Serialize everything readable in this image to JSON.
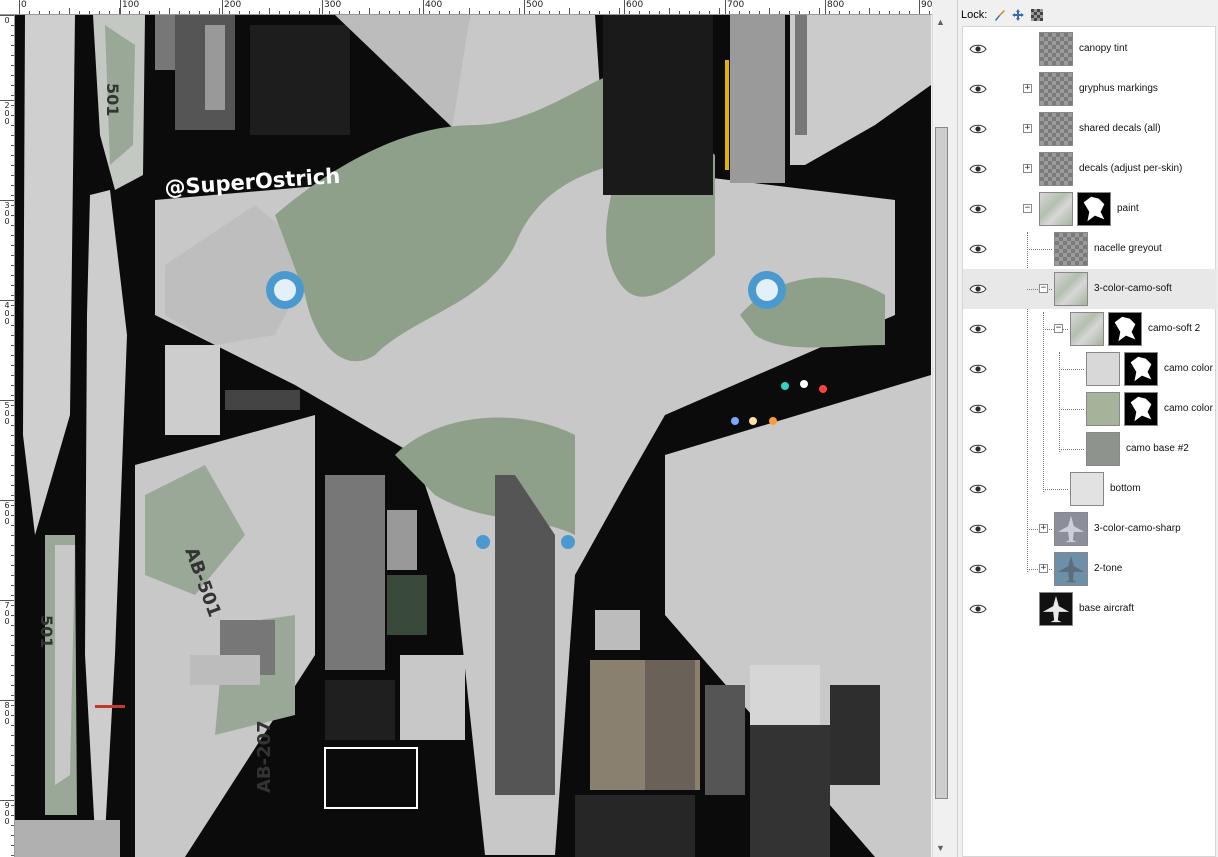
{
  "ruler": {
    "h_labels": [
      "0",
      "100",
      "200",
      "300",
      "400",
      "500",
      "600",
      "700",
      "800",
      "90"
    ],
    "v_labels": [
      "0",
      "200",
      "300",
      "400",
      "500",
      "600",
      "700",
      "800",
      "900"
    ]
  },
  "texture": {
    "watermark": "@SuperOstrich",
    "tail_codes": [
      "AB-501",
      "AB-207"
    ],
    "side_numbers": [
      "501",
      "501"
    ]
  },
  "panel": {
    "lock_label": "Lock:",
    "lock_icons": [
      "brush-icon",
      "move-icon",
      "alpha-icon"
    ]
  },
  "layers": [
    {
      "name": "canopy tint",
      "indent": 0,
      "expander": "",
      "thumb": "checker",
      "mask": false,
      "selected": false
    },
    {
      "name": "gryphus markings",
      "indent": 0,
      "expander": "+",
      "thumb": "checker",
      "mask": false,
      "selected": false
    },
    {
      "name": "shared decals (all)",
      "indent": 0,
      "expander": "+",
      "thumb": "checker",
      "mask": false,
      "selected": false
    },
    {
      "name": "decals (adjust per-skin)",
      "indent": 0,
      "expander": "+",
      "thumb": "checker",
      "mask": false,
      "selected": false
    },
    {
      "name": "paint",
      "indent": 0,
      "expander": "−",
      "thumb": "camo",
      "mask": true,
      "selected": false
    },
    {
      "name": "nacelle greyout",
      "indent": 1,
      "expander": "",
      "thumb": "checker",
      "mask": false,
      "selected": false
    },
    {
      "name": "3-color-camo-soft",
      "indent": 1,
      "expander": "−",
      "thumb": "camo",
      "mask": false,
      "selected": true
    },
    {
      "name": "camo-soft 2",
      "indent": 2,
      "expander": "−",
      "thumb": "camo",
      "mask": true,
      "selected": false
    },
    {
      "name": "camo color",
      "indent": 3,
      "expander": "",
      "thumb": "#d8d8d8",
      "mask": true,
      "selected": false
    },
    {
      "name": "camo color",
      "indent": 3,
      "expander": "",
      "thumb": "#a5b39b",
      "mask": true,
      "selected": false
    },
    {
      "name": "camo base #2",
      "indent": 3,
      "expander": "",
      "thumb": "#8e938d",
      "mask": false,
      "selected": false
    },
    {
      "name": "bottom",
      "indent": 2,
      "expander": "",
      "thumb": "#e2e2e2",
      "mask": false,
      "selected": false
    },
    {
      "name": "3-color-camo-sharp",
      "indent": 1,
      "expander": "+",
      "thumb": "jet-gray",
      "mask": false,
      "selected": false
    },
    {
      "name": "2-tone",
      "indent": 1,
      "expander": "+",
      "thumb": "jet-blue",
      "mask": false,
      "selected": false
    },
    {
      "name": "base aircraft",
      "indent": 0,
      "expander": "",
      "thumb": "jet-white",
      "mask": false,
      "selected": false
    }
  ]
}
